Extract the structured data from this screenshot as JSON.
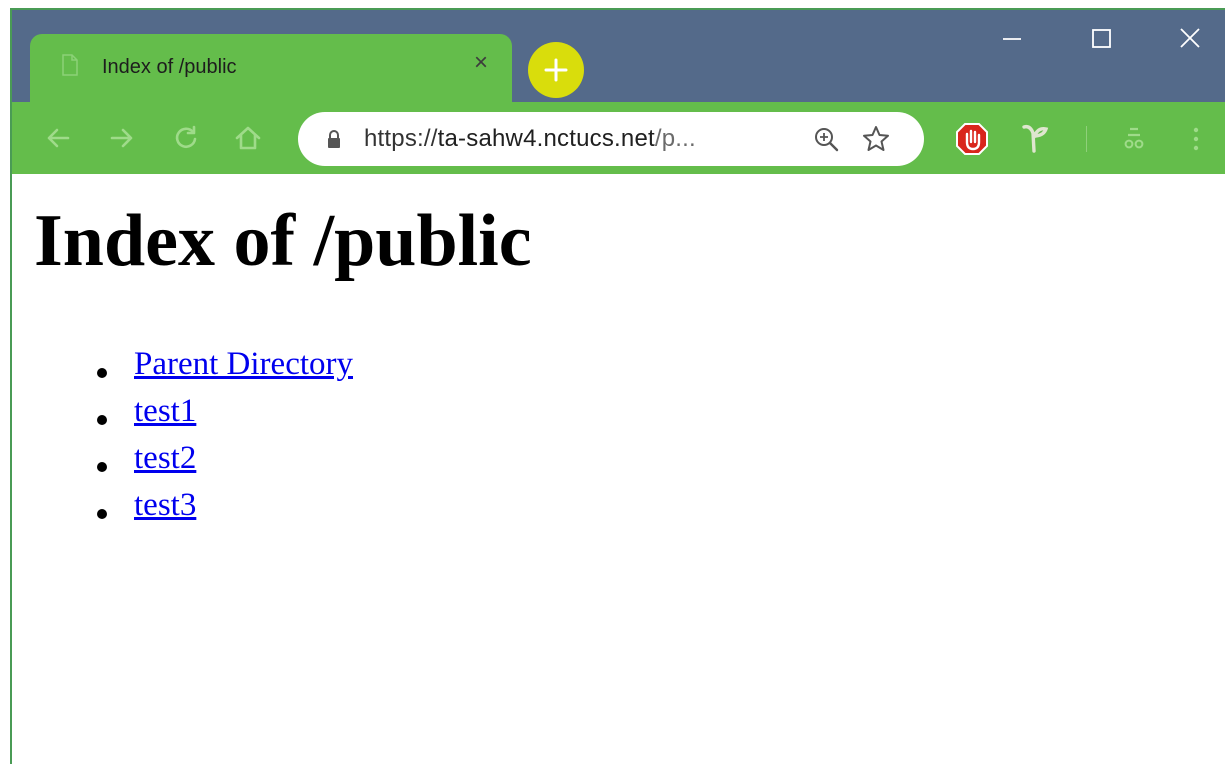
{
  "browser": {
    "tab": {
      "title": "Index of /public",
      "close_glyph": "×",
      "icon": "page-icon"
    },
    "new_tab_icon": "plus-icon",
    "window_controls": [
      "minimize-icon",
      "maximize-icon",
      "close-icon"
    ],
    "toolbar": {
      "nav_icons": [
        "back-arrow-icon",
        "forward-arrow-icon",
        "reload-icon",
        "home-icon"
      ],
      "address": {
        "scheme": "https://",
        "host": "ta-sahw4.nctucs.net",
        "rest": "/p...",
        "lock_icon": "lock-icon",
        "zoom_icon": "zoom-icon",
        "bookmark_icon": "star-icon"
      },
      "extension_icons": [
        "adblock-icon",
        "extension-icon",
        "cast-icon",
        "menu-icon"
      ]
    },
    "colors": {
      "titlebar": "#546a8a",
      "tab": "#64bd4b",
      "toolbar": "#64bd4b",
      "new_tab": "#d9dd0c",
      "link": "#0000ee"
    }
  },
  "page": {
    "heading": "Index of /public",
    "links": [
      {
        "label": "Parent Directory"
      },
      {
        "label": "test1"
      },
      {
        "label": "test2"
      },
      {
        "label": "test3"
      }
    ]
  }
}
